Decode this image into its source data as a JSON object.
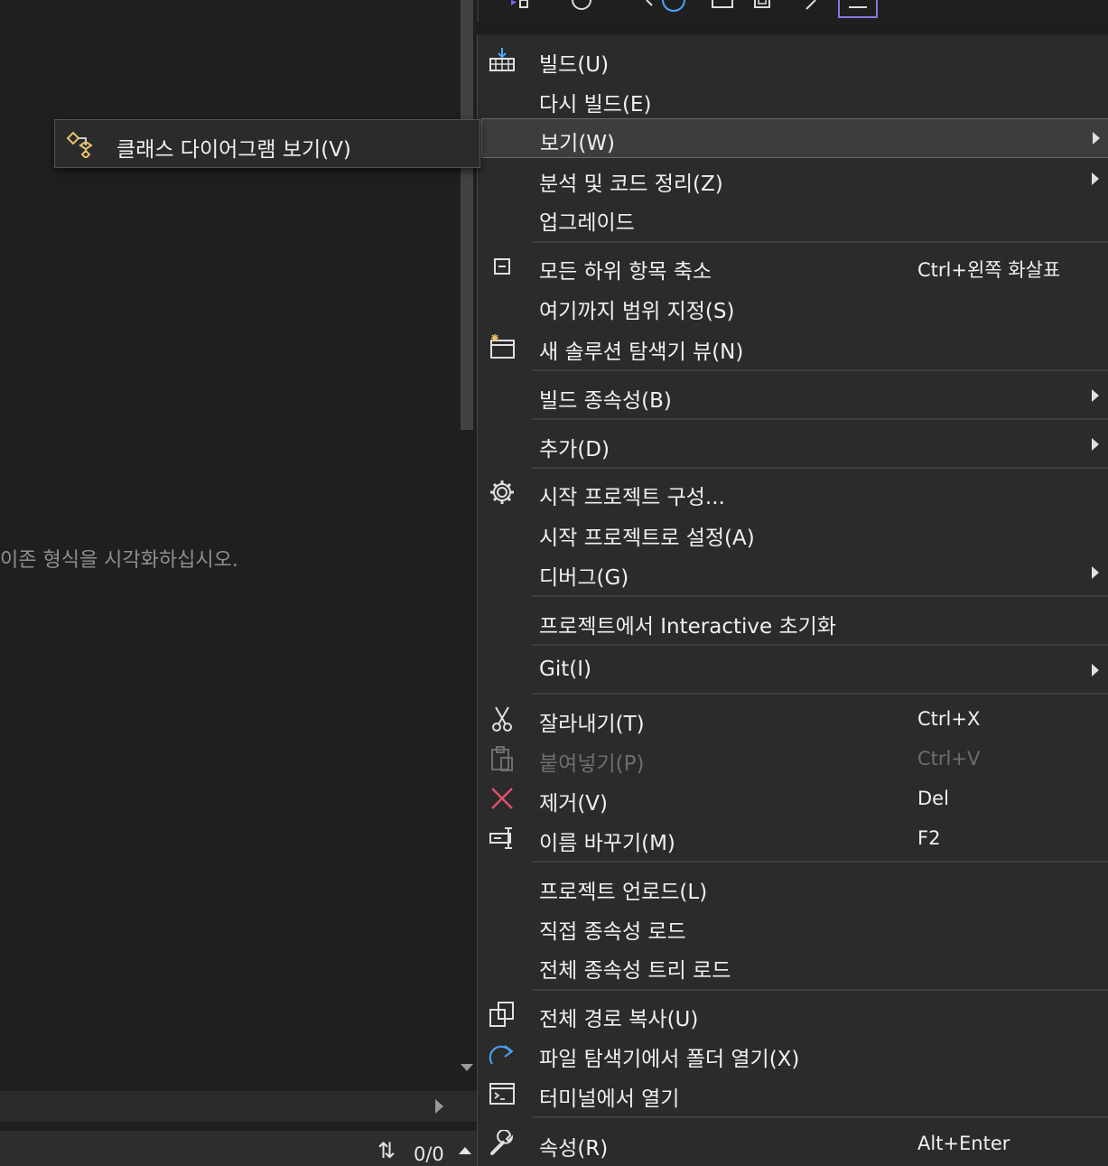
{
  "editor": {
    "message": "이존 형식을 시각화하십시오."
  },
  "status": {
    "count": "0/0"
  },
  "submenu": {
    "label": "클래스 다이어그램 보기(V)",
    "icon": "class-diagram-icon"
  },
  "menu": {
    "build": {
      "label": "빌드(U)",
      "icon": "build-icon"
    },
    "rebuild": {
      "label": "다시 빌드(E)"
    },
    "view": {
      "label": "보기(W)"
    },
    "analyze": {
      "label": "분석 및 코드 정리(Z)"
    },
    "upgrade": {
      "label": "업그레이드"
    },
    "collapse_all": {
      "label": "모든 하위 항목 축소",
      "shortcut": "Ctrl+왼쪽 화살표",
      "icon": "collapse-icon"
    },
    "scope_to_this": {
      "label": "여기까지 범위 지정(S)"
    },
    "new_view": {
      "label": "새 솔루션 탐색기 뷰(N)",
      "icon": "new-view-icon"
    },
    "build_dependencies": {
      "label": "빌드 종속성(B)"
    },
    "add": {
      "label": "추가(D)"
    },
    "configure_startup": {
      "label": "시작 프로젝트 구성...",
      "icon": "gear-icon"
    },
    "set_startup": {
      "label": "시작 프로젝트로 설정(A)"
    },
    "debug": {
      "label": "디버그(G)"
    },
    "init_interactive": {
      "label": "프로젝트에서 Interactive 초기화"
    },
    "git": {
      "label": "Git(I)"
    },
    "cut": {
      "label": "잘라내기(T)",
      "shortcut": "Ctrl+X",
      "icon": "scissors-icon"
    },
    "paste": {
      "label": "붙여넣기(P)",
      "shortcut": "Ctrl+V",
      "icon": "clipboard-icon"
    },
    "remove": {
      "label": "제거(V)",
      "shortcut": "Del",
      "icon": "close-icon"
    },
    "rename": {
      "label": "이름 바꾸기(M)",
      "shortcut": "F2",
      "icon": "rename-icon"
    },
    "unload": {
      "label": "프로젝트 언로드(L)"
    },
    "load_direct": {
      "label": "직접 종속성 로드"
    },
    "load_all": {
      "label": "전체 종속성 트리 로드"
    },
    "copy_path": {
      "label": "전체 경로 복사(U)",
      "icon": "copy-icon"
    },
    "open_folder": {
      "label": "파일 탐색기에서 폴더 열기(X)",
      "icon": "redo-arrow-icon"
    },
    "open_terminal": {
      "label": "터미널에서 열기",
      "icon": "terminal-icon"
    },
    "properties": {
      "label": "속성(R)",
      "shortcut": "Alt+Enter",
      "icon": "wrench-icon"
    }
  },
  "colors": {
    "menu_bg": "#2b2b2b",
    "highlight_bg": "#3d3d3d",
    "remove_icon": "#e0506a",
    "accent": "#4aa3ff",
    "disabled_text": "#6e6e6e"
  }
}
